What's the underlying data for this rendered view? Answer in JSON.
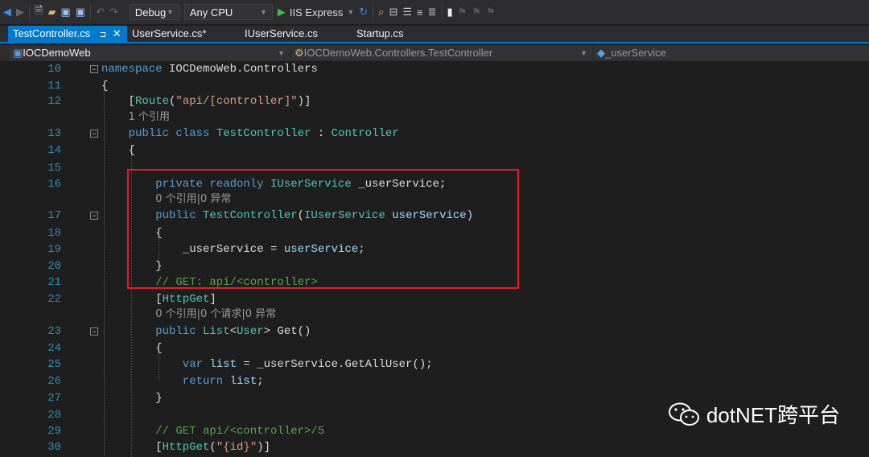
{
  "toolbar": {
    "config": "Debug",
    "platform": "Any CPU",
    "run": "IIS Express"
  },
  "tabs": [
    {
      "label": "TestController.cs",
      "active": true
    },
    {
      "label": "UserService.cs*"
    },
    {
      "label": "IUserService.cs"
    },
    {
      "label": "Startup.cs"
    }
  ],
  "navbar": {
    "project": "IOCDemoWeb",
    "type": "IOCDemoWeb.Controllers.TestController",
    "member": "_userService"
  },
  "lines": [
    {
      "n": "10",
      "fold": true,
      "indent": 0,
      "t": [
        [
          "kw",
          "namespace "
        ],
        [
          "id",
          "IOCDemoWeb.Controllers"
        ]
      ]
    },
    {
      "n": "11",
      "indent": 0,
      "t": [
        [
          "id",
          "{"
        ]
      ]
    },
    {
      "n": "12",
      "indent": 1,
      "t": [
        [
          "id",
          "["
        ],
        [
          "at",
          "Route"
        ],
        [
          "id",
          "("
        ],
        [
          "st",
          "\"api/[controller]\""
        ],
        [
          "id",
          ")]"
        ]
      ]
    },
    {
      "lens": "1 个引用",
      "indent": 1
    },
    {
      "n": "13",
      "fold": true,
      "indent": 1,
      "t": [
        [
          "kw",
          "public class "
        ],
        [
          "ty",
          "TestController"
        ],
        [
          "id",
          " : "
        ],
        [
          "ty",
          "Controller"
        ]
      ]
    },
    {
      "n": "14",
      "indent": 1,
      "t": [
        [
          "id",
          "{"
        ]
      ]
    },
    {
      "n": "15",
      "indent": 0,
      "t": []
    },
    {
      "n": "16",
      "indent": 2,
      "t": [
        [
          "kw",
          "private readonly "
        ],
        [
          "ty",
          "IUserService"
        ],
        [
          "id",
          " _userService;"
        ]
      ]
    },
    {
      "lens": "0 个引用|0 异常",
      "indent": 2
    },
    {
      "n": "17",
      "fold": true,
      "indent": 2,
      "t": [
        [
          "kw",
          "public "
        ],
        [
          "ty",
          "TestController"
        ],
        [
          "id",
          "("
        ],
        [
          "ty",
          "IUserService"
        ],
        [
          "pr",
          " userService"
        ],
        [
          "id",
          ")"
        ]
      ]
    },
    {
      "n": "18",
      "indent": 2,
      "t": [
        [
          "id",
          "{"
        ]
      ]
    },
    {
      "n": "19",
      "indent": 3,
      "t": [
        [
          "id",
          "_userService = "
        ],
        [
          "pr",
          "userService"
        ],
        [
          "id",
          ";"
        ]
      ]
    },
    {
      "n": "20",
      "indent": 2,
      "t": [
        [
          "id",
          "}"
        ]
      ]
    },
    {
      "n": "21",
      "indent": 2,
      "t": [
        [
          "cm",
          "// GET: api/<controller>"
        ]
      ]
    },
    {
      "n": "22",
      "indent": 2,
      "t": [
        [
          "id",
          "["
        ],
        [
          "at",
          "HttpGet"
        ],
        [
          "id",
          "]"
        ]
      ]
    },
    {
      "lens": "0 个引用|0 个请求|0 异常",
      "indent": 2
    },
    {
      "n": "23",
      "fold": true,
      "indent": 2,
      "t": [
        [
          "kw",
          "public "
        ],
        [
          "ty",
          "List"
        ],
        [
          "id",
          "<"
        ],
        [
          "ty",
          "User"
        ],
        [
          "id",
          "> Get()"
        ]
      ]
    },
    {
      "n": "24",
      "indent": 2,
      "t": [
        [
          "id",
          "{"
        ]
      ]
    },
    {
      "n": "25",
      "indent": 3,
      "t": [
        [
          "kw",
          "var "
        ],
        [
          "pr",
          "list"
        ],
        [
          "id",
          " = _userService.GetAllUser();"
        ]
      ]
    },
    {
      "n": "26",
      "indent": 3,
      "t": [
        [
          "kw",
          "return "
        ],
        [
          "pr",
          "list"
        ],
        [
          "id",
          ";"
        ]
      ]
    },
    {
      "n": "27",
      "indent": 2,
      "t": [
        [
          "id",
          "}"
        ]
      ]
    },
    {
      "n": "28",
      "indent": 0,
      "t": []
    },
    {
      "n": "29",
      "indent": 2,
      "t": [
        [
          "cm",
          "// GET api/<controller>/5"
        ]
      ]
    },
    {
      "n": "30",
      "indent": 2,
      "t": [
        [
          "id",
          "["
        ],
        [
          "at",
          "HttpGet"
        ],
        [
          "id",
          "("
        ],
        [
          "st",
          "\"{id}\""
        ],
        [
          "id",
          ")]"
        ]
      ]
    }
  ],
  "watermark": {
    "text": "dotNET跨平台"
  }
}
